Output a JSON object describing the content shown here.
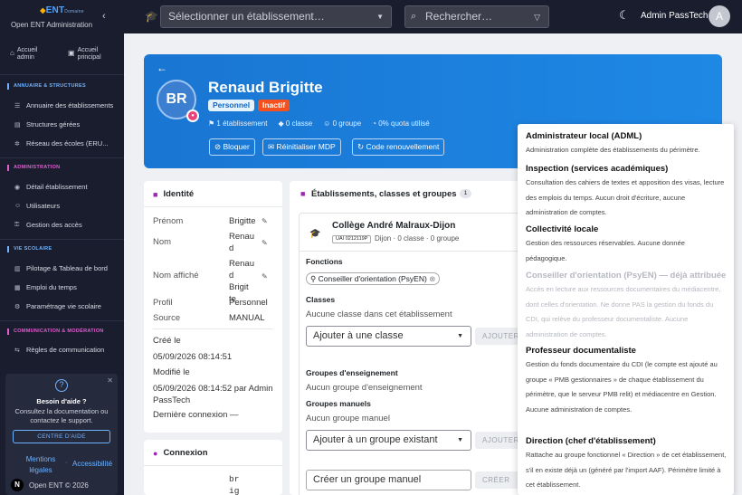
{
  "brand": {
    "logo_a": "ENT",
    "logo_b": "Domaine",
    "subtitle": "Open ENT Administration"
  },
  "sidebar": {
    "top": [
      {
        "label": "Accueil admin",
        "icon": "home-icon"
      },
      {
        "label": "Accueil principal",
        "icon": "layout-icon"
      }
    ],
    "sections": [
      {
        "title": "ANNUAIRE & STRUCTURES",
        "items": [
          "Annuaire des établissements",
          "Structures gérées",
          "Réseau des écoles (ERU..."
        ]
      },
      {
        "title": "ADMINISTRATION",
        "items": [
          "Détail établissement",
          "Utilisateurs",
          "Gestion des accès"
        ]
      },
      {
        "title": "VIE SCOLAIRE",
        "items": [
          "Pilotage & Tableau de bord",
          "Emploi du temps",
          "Paramétrage vie scolaire"
        ]
      },
      {
        "title": "COMMUNICATION & MODÉRATION",
        "items": [
          "Règles de communication"
        ]
      }
    ],
    "help": {
      "title": "Besoin d'aide ?",
      "text": "Consultez la documentation ou contactez le support.",
      "button": "CENTRE D'AIDE",
      "link1": "Mentions légales",
      "link2": "Accessibilité"
    },
    "footer": "Open ENT © 2026"
  },
  "topbar": {
    "select_placeholder": "Sélectionner un établissement…",
    "search_placeholder": "Rechercher…",
    "user": "Admin PassTech",
    "avatar": "A"
  },
  "profile": {
    "initials": "BR",
    "name": "Renaud Brigitte",
    "badge_profile": "Personnel",
    "badge_status": "Inactif",
    "stats": [
      "1 établissement",
      "0 classe",
      "0 groupe",
      "0% quota utilisé"
    ],
    "buttons": [
      "Bloquer",
      "Réinitialiser MDP",
      "Code renouvellement"
    ]
  },
  "identity": {
    "title": "Identité",
    "rows": [
      {
        "label": "Prénom",
        "value": "Brigitte"
      },
      {
        "label": "Nom",
        "value": "Renau d"
      },
      {
        "label": "Nom affiché",
        "value": "Renau d Brigit te"
      },
      {
        "label": "Profil",
        "value": "Personnel"
      },
      {
        "label": "Source",
        "value": "MANUAL"
      }
    ],
    "created_label": "Créé le",
    "created": "05/09/2026 08:14:51",
    "modified_label": "Modifié le",
    "modified": "05/09/2026 08:14:52 par Admin PassTech",
    "last_label": "Dernière connexion",
    "last": "—"
  },
  "connexion": {
    "title": "Connexion",
    "value": "br ig"
  },
  "etab": {
    "title": "Établissements, classes et groupes",
    "count": "1",
    "name": "Collège André Malraux-Dijon",
    "uai": "UAI 0212119P",
    "meta": "Dijon · 0 classe · 0 groupe",
    "fonctions_label": "Fonctions",
    "fonction_chip": "Conseiller d'orientation (PsyEN)",
    "classes_label": "Classes",
    "classes_empty": "Aucune classe dans cet établissement",
    "add_class": "Ajouter à une classe",
    "add_btn": "AJOUTER",
    "groupes_ens_label": "Groupes d'enseignement",
    "groupes_ens_empty": "Aucun groupe d'enseignement",
    "groupes_man_label": "Groupes manuels",
    "groupes_man_empty": "Aucun groupe manuel",
    "add_group": "Ajouter à un groupe existant",
    "add_group_btn": "AJOUTER",
    "create_group": "Créer un groupe manuel",
    "create_btn": "CRÉER"
  },
  "popover": [
    {
      "title": "Administrateur local (ADML)",
      "desc": "Administration complète des établissements du périmètre.",
      "disabled": false
    },
    {
      "title": "Inspection (services académiques)",
      "desc": "Consultation des cahiers de textes et apposition des visas, lecture des emplois du temps. Aucun droit d'écriture, aucune administration de comptes.",
      "disabled": false
    },
    {
      "title": "Collectivité locale",
      "desc": "Gestion des ressources réservables. Aucune donnée pédagogique.",
      "disabled": false
    },
    {
      "title": "Conseiller d'orientation (PsyEN) — déjà attribuée",
      "desc": "Accès en lecture aux ressources documentaires du médiacentre, dont celles d'orientation. Ne donne PAS la gestion du fonds du CDI, qui relève du professeur documentaliste. Aucune administration de comptes.",
      "disabled": true
    },
    {
      "title": "Professeur documentaliste",
      "desc": "Gestion du fonds documentaire du CDI (le compte est ajouté au groupe « PMB gestionnaires » de chaque établissement du périmètre, que le serveur PMB relit) et médiacentre en Gestion. Aucune administration de comptes.",
      "disabled": false
    },
    {
      "title": "Direction (chef d'établissement)",
      "desc": "Rattache au groupe fonctionnel « Direction » de cet établissement, s'il en existe déjà un (généré par l'import AAF). Périmètre limité à cet établissement.",
      "disabled": false
    }
  ]
}
